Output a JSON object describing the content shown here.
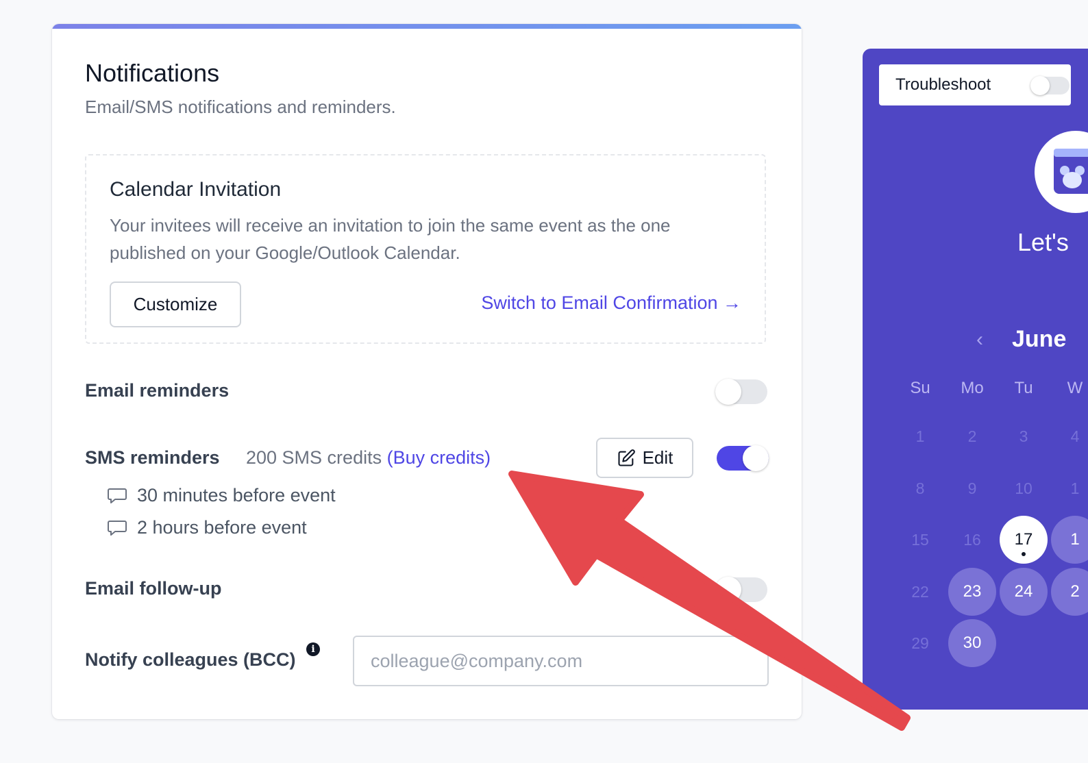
{
  "notifications": {
    "title": "Notifications",
    "subtitle": "Email/SMS notifications and reminders.",
    "calendar_invitation": {
      "title": "Calendar Invitation",
      "description": "Your invitees will receive an invitation to join the same event as the one published on your Google/Outlook Calendar.",
      "customize_label": "Customize",
      "switch_link": "Switch to Email Confirmation →"
    },
    "email_reminders": {
      "label": "Email reminders",
      "enabled": false
    },
    "sms_reminders": {
      "label": "SMS reminders",
      "credits_text": "200 SMS credits",
      "buy_credits": "(Buy credits)",
      "edit_label": "Edit",
      "enabled": true,
      "items": [
        "30 minutes before event",
        "2 hours before event"
      ]
    },
    "email_followup": {
      "label": "Email follow-up",
      "enabled": false
    },
    "notify_colleagues": {
      "label": "Notify colleagues (BCC)",
      "info_icon": "i",
      "placeholder": "colleague@company.com"
    }
  },
  "preview": {
    "troubleshoot_label": "Troubleshoot",
    "troubleshoot_enabled": false,
    "greeting": "Let's",
    "month": "June",
    "weekdays": [
      "Su",
      "Mo",
      "Tu",
      "W"
    ],
    "weeks": [
      [
        "1",
        "2",
        "3",
        "4"
      ],
      [
        "8",
        "9",
        "10",
        "1"
      ],
      [
        "15",
        "16",
        "17",
        "1"
      ],
      [
        "22",
        "23",
        "24",
        "2"
      ],
      [
        "29",
        "30"
      ]
    ],
    "today": "17",
    "available_days": [
      "23",
      "24",
      "30"
    ]
  },
  "colors": {
    "accent": "#4f46e5",
    "preview_bg": "#4f46c4",
    "annotation_arrow": "#e5484d"
  },
  "icons": {
    "edit": "pencil-square-icon",
    "reminder": "chat-bubble-icon",
    "prev_month": "chevron-left-icon",
    "info": "info-circle-icon"
  }
}
